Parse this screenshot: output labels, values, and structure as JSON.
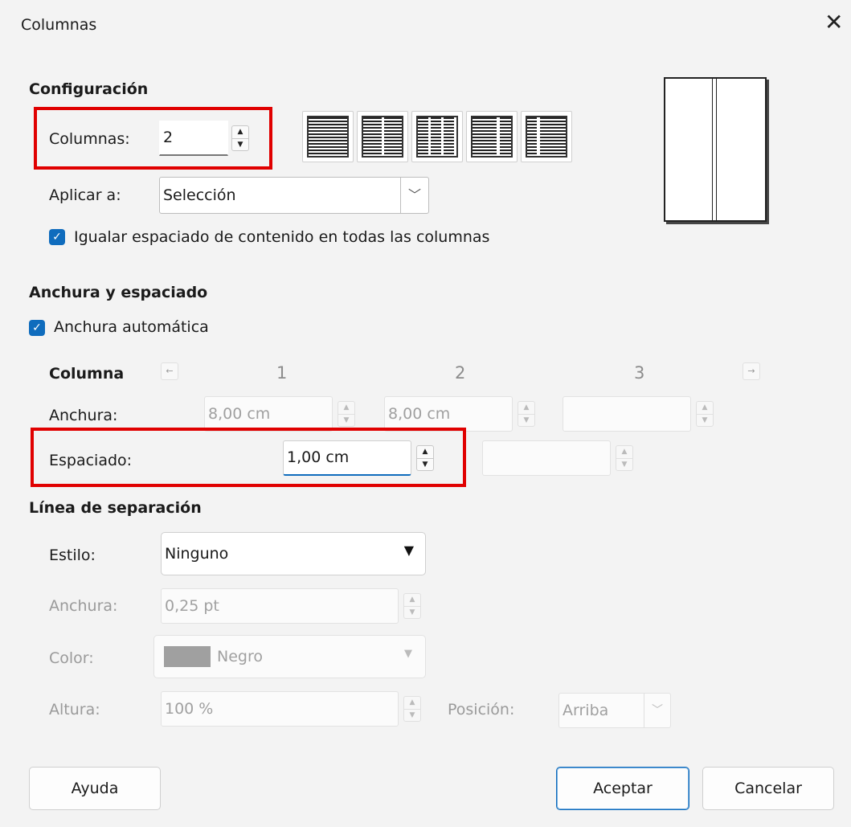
{
  "window": {
    "title": "Columnas",
    "close_glyph": "✕"
  },
  "config": {
    "heading": "Configuración",
    "columns_label": "Columnas:",
    "columns_value": "2",
    "apply_label": "Aplicar a:",
    "apply_value": "Selección",
    "equalize_label": "Igualar espaciado de contenido en todas las columnas",
    "equalize_checked": true
  },
  "width_spacing": {
    "heading": "Anchura y espaciado",
    "auto_width_label": "Anchura automática",
    "auto_width_checked": true,
    "column_label": "Columna",
    "col_numbers": [
      "1",
      "2",
      "3"
    ],
    "width_label": "Anchura:",
    "widths": [
      "8,00 cm",
      "8,00 cm",
      ""
    ],
    "spacing_label": "Espaciado:",
    "spacings": [
      "1,00 cm",
      ""
    ]
  },
  "separator": {
    "heading": "Línea de separación",
    "style_label": "Estilo:",
    "style_value": "Ninguno",
    "width_label": "Anchura:",
    "width_value": "0,25 pt",
    "color_label": "Color:",
    "color_value": "Negro",
    "color_swatch": "#a0a0a0",
    "height_label": "Altura:",
    "height_value": "100 %",
    "position_label": "Posición:",
    "position_value": "Arriba"
  },
  "buttons": {
    "help": "Ayuda",
    "ok": "Aceptar",
    "cancel": "Cancelar"
  },
  "colors": {
    "highlight": "#e00000",
    "accent": "#0f6cbd"
  }
}
